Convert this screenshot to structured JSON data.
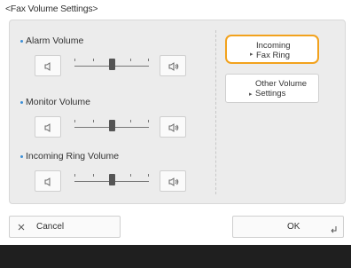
{
  "window": {
    "title": "<Fax Volume Settings>"
  },
  "volumes": [
    {
      "label": "Alarm Volume",
      "level": 2,
      "max": 4
    },
    {
      "label": "Monitor Volume",
      "level": 2,
      "max": 4
    },
    {
      "label": "Incoming Ring Volume",
      "level": 2,
      "max": 4
    }
  ],
  "side_buttons": [
    {
      "line1": "Incoming",
      "line2": "Fax Ring",
      "selected": true
    },
    {
      "line1": "Other Volume",
      "line2": "Settings",
      "selected": false
    }
  ],
  "bottom_buttons": {
    "cancel_label": "Cancel",
    "ok_label": "OK"
  },
  "colors": {
    "selected_border": "#f2a21d",
    "bullet": "#3d8fd6"
  },
  "icons": {
    "volume_down": "speaker-quiet-icon",
    "volume_up": "speaker-loud-icon",
    "cancel": "close-icon",
    "ok": "enter-icon"
  }
}
